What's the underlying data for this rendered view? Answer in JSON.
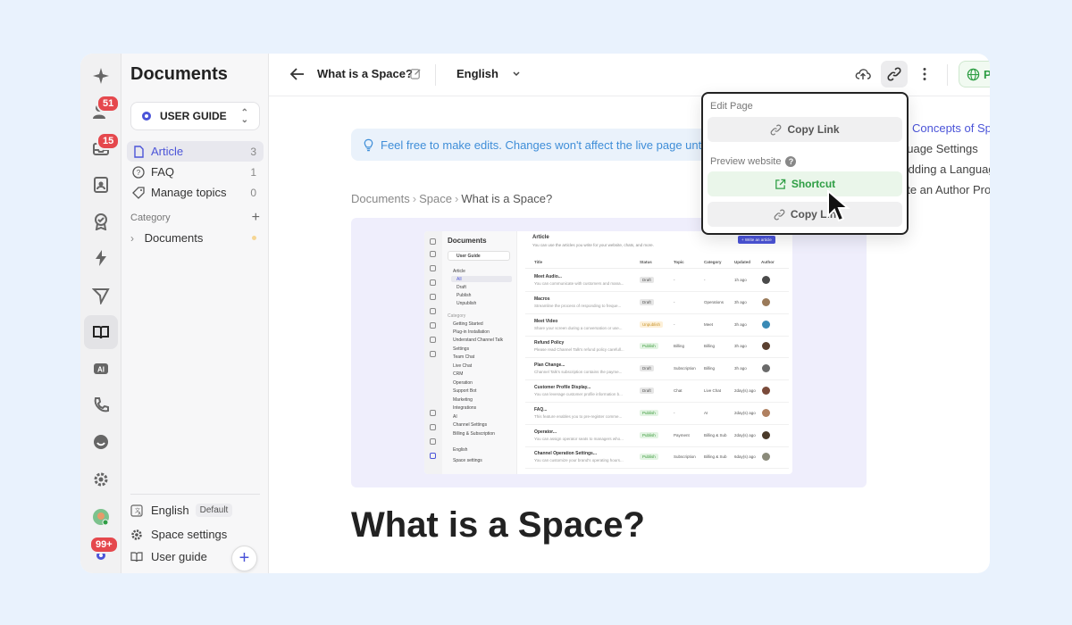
{
  "rail": {
    "contacts_badge": "51",
    "inbox_badge": "15",
    "user_badge": "99+"
  },
  "sidebar": {
    "title": "Documents",
    "space": "USER GUIDE",
    "items": [
      {
        "label": "Article",
        "count": "3"
      },
      {
        "label": "FAQ",
        "count": "1"
      },
      {
        "label": "Manage topics",
        "count": "0"
      }
    ],
    "category_label": "Category",
    "category_item": "Documents",
    "footer": {
      "language": "English",
      "default_badge": "Default",
      "space_settings": "Space settings",
      "user_guide": "User guide"
    }
  },
  "topbar": {
    "page_title": "What is a Space?",
    "language": "English",
    "publish_label": "P"
  },
  "main": {
    "tip": "Feel free to make edits. Changes won't affect the live page until",
    "breadcrumb": [
      "Documents",
      "Space",
      "What is a Space?"
    ],
    "heading": "What is a Space?"
  },
  "toc": [
    "ic Concepts of Sp",
    "guage Settings",
    "Adding a Languag",
    "ate an Author Pro"
  ],
  "popup": {
    "edit_page_label": "Edit Page",
    "copy_link_1": "Copy Link",
    "preview_label": "Preview website",
    "shortcut": "Shortcut",
    "copy_link_2": "Copy Lin"
  },
  "mini": {
    "title": "Documents",
    "space": "User Guide",
    "header": "Article",
    "subheader": "You can use the articles you write for your website, chats, and more.",
    "write_btn": "+ Write an article",
    "sidebar_lines": [
      "Article",
      "All",
      "Draft",
      "Publish",
      "Unpublish",
      "Category",
      "Getting Started",
      "Plug-in Installation",
      "Understand Channel Talk",
      "Settings",
      "Team Chat",
      "Live Chat",
      "CRM",
      "Operation",
      "Support Bot",
      "Marketing",
      "Integrations",
      "AI",
      "Channel Settings",
      "Billing & Subscription",
      "English",
      "Space settings"
    ],
    "columns": [
      "Title",
      "Status",
      "Topic",
      "Category",
      "Updated",
      "Author"
    ],
    "rows": [
      {
        "title": "Meet Audio...",
        "desc": "You can communicate with customers and mana...",
        "status": "Draft",
        "topic": "-",
        "category": "-",
        "updated": "1h ago"
      },
      {
        "title": "Macros",
        "desc": "Streamline the process of responding to freque...",
        "status": "Draft",
        "topic": "-",
        "category": "Operations",
        "updated": "3h ago"
      },
      {
        "title": "Meet Video",
        "desc": "Share your screen during a conversation or use...",
        "status": "Unpublish",
        "topic": "-",
        "category": "Meet",
        "updated": "3h ago"
      },
      {
        "title": "Refund Policy",
        "desc": "Please read Channel Talk's refund policy carefull...",
        "status": "Publish",
        "topic": "Billing",
        "category": "Billing",
        "updated": "3h ago"
      },
      {
        "title": "Plan Change...",
        "desc": "Channel Talk's subscription contains the payme...",
        "status": "Draft",
        "topic": "Subscription",
        "category": "Billing",
        "updated": "3h ago"
      },
      {
        "title": "Customer Profile Display...",
        "desc": "You can leverage customer profile information b...",
        "status": "Draft",
        "topic": "Chat",
        "category": "Live Chat",
        "updated": "2day(s) ago"
      },
      {
        "title": "FAQ...",
        "desc": "This feature enables you to pre-register comme...",
        "status": "Publish",
        "topic": "-",
        "category": "AI",
        "updated": "2day(s) ago"
      },
      {
        "title": "Operator...",
        "desc": "You can assign operator seats to managers who...",
        "status": "Publish",
        "topic": "Payment",
        "category": "Billing & Sub",
        "updated": "2day(s) ago"
      },
      {
        "title": "Channel Operation Settings...",
        "desc": "You can customize your brand's operating hours...",
        "status": "Publish",
        "topic": "Subscription",
        "category": "Billing & Sub",
        "updated": "6day(s) ago"
      }
    ]
  }
}
